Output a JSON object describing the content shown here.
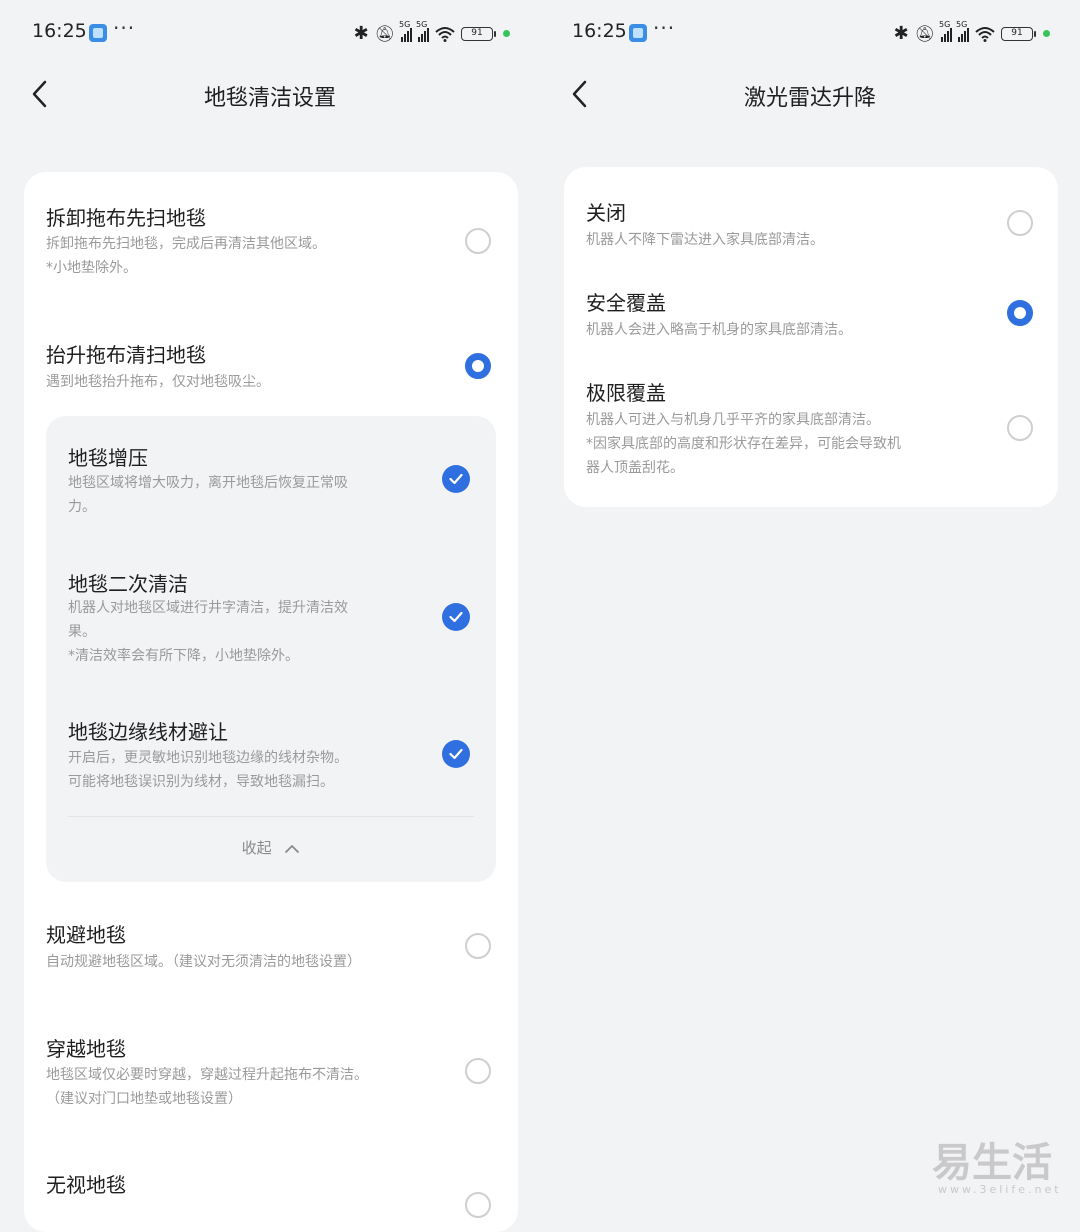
{
  "left": {
    "status": {
      "time": "16:25",
      "more": "···",
      "battery": "91",
      "network": [
        "5G",
        "5G"
      ]
    },
    "title": "地毯清洁设置",
    "items": [
      {
        "name": "拆卸拖布先扫地毯",
        "desc": [
          "拆卸拖布先扫地毯，完成后再清洁其他区域。",
          "*小地垫除外。"
        ],
        "selected": false
      },
      {
        "name": "抬升拖布清扫地毯",
        "desc": [
          "遇到地毯抬升拖布，仅对地毯吸尘。"
        ],
        "selected": true
      },
      {
        "name": "规避地毯",
        "desc": [
          "自动规避地毯区域。（建议对无须清洁的地毯设置）"
        ],
        "selected": false
      },
      {
        "name": "穿越地毯",
        "desc": [
          "地毯区域仅必要时穿越，穿越过程升起拖布不清洁。",
          "（建议对门口地垫或地毯设置）"
        ],
        "selected": false
      },
      {
        "name": "无视地毯",
        "desc": [],
        "selected": false
      }
    ],
    "sub_options": [
      {
        "name": "地毯增压",
        "desc": [
          "地毯区域将增大吸力，离开地毯后恢复正常吸",
          "力。"
        ],
        "checked": true
      },
      {
        "name": "地毯二次清洁",
        "desc": [
          "机器人对地毯区域进行井字清洁，提升清洁效",
          "果。",
          "*清洁效率会有所下降，小地垫除外。"
        ],
        "checked": true
      },
      {
        "name": "地毯边缘线材避让",
        "desc": [
          "开启后，更灵敏地识别地毯边缘的线材杂物。",
          "可能将地毯误识别为线材，导致地毯漏扫。"
        ],
        "checked": true
      }
    ],
    "collapse_label": "收起"
  },
  "right": {
    "status": {
      "time": "16:25",
      "more": "···",
      "battery": "91",
      "network": [
        "5G",
        "5G"
      ]
    },
    "title": "激光雷达升降",
    "options": [
      {
        "name": "关闭",
        "desc": [
          "机器人不降下雷达进入家具底部清洁。"
        ],
        "selected": false
      },
      {
        "name": "安全覆盖",
        "desc": [
          "机器人会进入略高于机身的家具底部清洁。"
        ],
        "selected": true
      },
      {
        "name": "极限覆盖",
        "desc": [
          "机器人可进入与机身几乎平齐的家具底部清洁。",
          "*因家具底部的高度和形状存在差异，可能会导致机",
          "器人顶盖刮花。"
        ],
        "selected": false
      }
    ]
  },
  "watermark": {
    "text": "易生活",
    "url": "www.3elife.net"
  },
  "colors": {
    "accent": "#2f6fe0",
    "background": "#f2f3f5",
    "card": "#ffffff",
    "secondary_text": "#9a9a9a"
  }
}
